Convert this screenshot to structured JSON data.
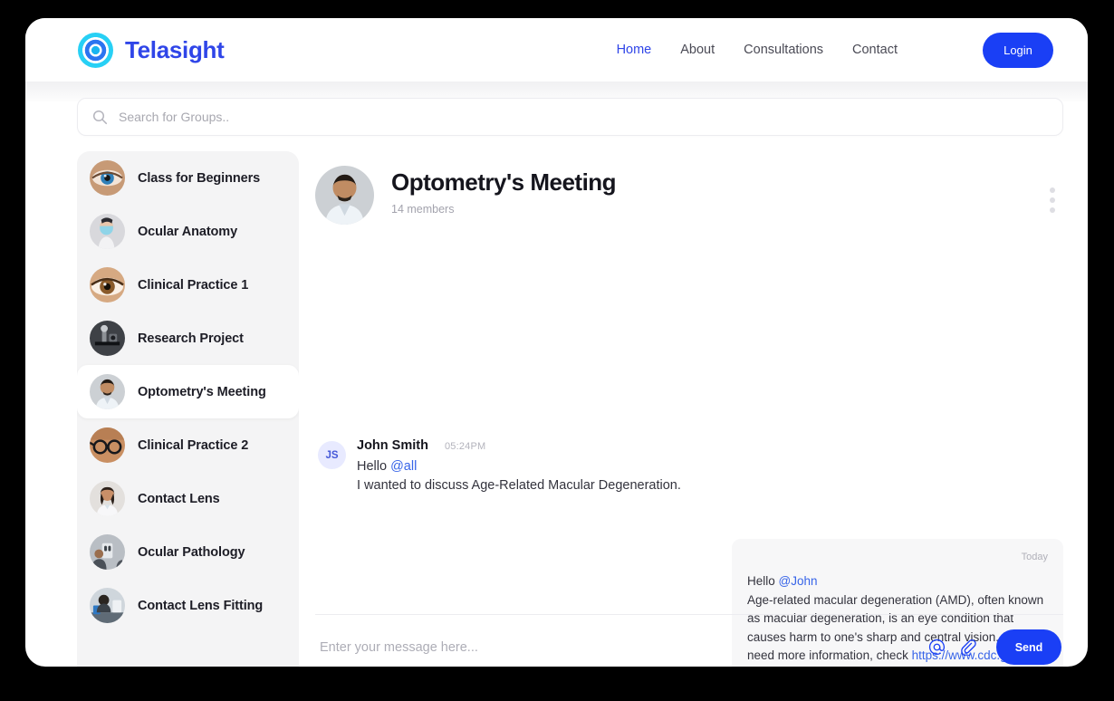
{
  "brand": {
    "name": "Telasight",
    "logo_icon": "eye-iris-logo",
    "logo_color": "#2f45e8"
  },
  "nav": {
    "links": [
      {
        "label": "Home",
        "active": true
      },
      {
        "label": "About",
        "active": false
      },
      {
        "label": "Consultations",
        "active": false
      },
      {
        "label": "Contact",
        "active": false
      }
    ],
    "login_label": "Login",
    "login_color": "#1a3ff5"
  },
  "search": {
    "placeholder": "Search for Groups..",
    "value": "",
    "icon": "search-icon"
  },
  "sidebar": {
    "groups": [
      {
        "label": "Class for Beginners",
        "avatar": "eye-closeup-photo",
        "active": false
      },
      {
        "label": "Ocular Anatomy",
        "avatar": "doctor-mask-photo",
        "active": false
      },
      {
        "label": "Clinical Practice 1",
        "avatar": "brown-eye-photo",
        "active": false
      },
      {
        "label": "Research Project",
        "avatar": "lab-equipment-photo",
        "active": false
      },
      {
        "label": "Optometry's Meeting",
        "avatar": "male-doctor-photo",
        "active": true
      },
      {
        "label": "Clinical Practice 2",
        "avatar": "eyeglasses-photo",
        "active": false
      },
      {
        "label": "Contact Lens",
        "avatar": "female-doctor-photo",
        "active": false
      },
      {
        "label": "Ocular Pathology",
        "avatar": "eye-exam-photo",
        "active": false
      },
      {
        "label": "Contact Lens Fitting",
        "avatar": "clinic-desk-photo",
        "active": false
      }
    ]
  },
  "chat": {
    "title": "Optometry's Meeting",
    "members": "14 members",
    "avatar": "male-doctor-photo",
    "menu_icon": "kebab-menu-icon",
    "messages": [
      {
        "type": "incoming",
        "initials": "JS",
        "sender": "John Smith",
        "time": "05:24PM",
        "greeting_prefix": "Hello ",
        "mention": "@all",
        "body": "I wanted to discuss Age-Related Macular Degeneration."
      },
      {
        "type": "outgoing",
        "date": "Today",
        "greeting_prefix": "Hello ",
        "mention": "@John",
        "body": "Age-related macular degeneration (AMD), often known as macular degeneration, is an eye condition that causes harm to one's sharp and central vision. If you need more information, check ",
        "link": "https://www.cdc.gov/visionhealth/basics/ced/index.html"
      }
    ]
  },
  "composer": {
    "placeholder": "Enter your message here...",
    "value": "",
    "mention_icon": "at-mention-icon",
    "attach_icon": "paperclip-icon",
    "send_label": "Send"
  }
}
